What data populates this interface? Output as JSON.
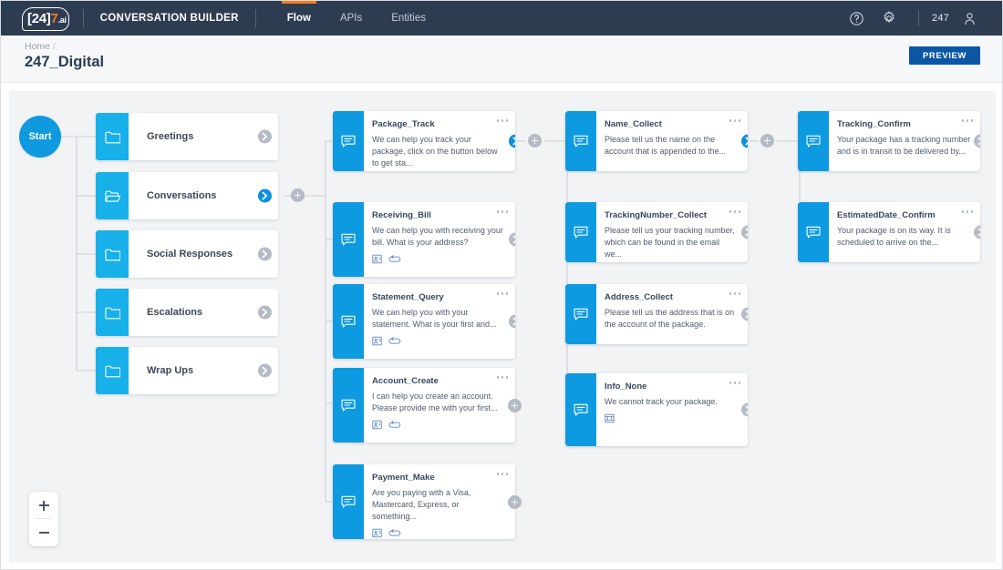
{
  "topnav": {
    "logo": {
      "bracket_left": "[",
      "num24": "24",
      "bracket_right": "]",
      "num7": "7",
      "suffix": ".ai"
    },
    "product": "CONVERSATION BUILDER",
    "tabs": [
      {
        "label": "Flow",
        "active": true
      },
      {
        "label": "APIs",
        "active": false
      },
      {
        "label": "Entities",
        "active": false
      }
    ],
    "help_icon": "question-circle-icon",
    "settings_icon": "gear-icon",
    "account": "247",
    "avatar_icon": "user-icon"
  },
  "subheader": {
    "breadcrumb_home": "Home",
    "breadcrumb_slash": "/",
    "title": "247_Digital",
    "preview_label": "PREVIEW"
  },
  "canvas": {
    "start_label": "Start",
    "zoom_in_label": "+",
    "zoom_out_label": "−"
  },
  "colors": {
    "nav_bg": "#2e3c52",
    "accent_orange": "#f47b20",
    "folder_blue": "#17b0e8",
    "node_blue": "#0e9ae0",
    "start_blue": "#0f9ae0",
    "preview_blue": "#0b57a4",
    "canvas_bg": "#f2f3f5",
    "arrow_grey": "#b4bbc4",
    "arrow_active": "#0b8fe0"
  },
  "folders": [
    {
      "label": "Greetings",
      "icon": "folder-icon",
      "arrow": "chevron-right-icon",
      "arrow_active": false
    },
    {
      "label": "Conversations",
      "icon": "folder-open-icon",
      "arrow": "chevron-right-icon",
      "arrow_active": true
    },
    {
      "label": "Social Responses",
      "icon": "folder-icon",
      "arrow": "chevron-right-icon",
      "arrow_active": false
    },
    {
      "label": "Escalations",
      "icon": "folder-icon",
      "arrow": "chevron-right-icon",
      "arrow_active": false
    },
    {
      "label": "Wrap Ups",
      "icon": "folder-icon",
      "arrow": "chevron-right-icon",
      "arrow_active": false
    }
  ],
  "column2": [
    {
      "title": "Package_Track",
      "text": "We can help you track your package, click on the button below to get sta...",
      "icons": [
        "button-icon"
      ],
      "menu": "more-options-icon",
      "out": "chevron-right-icon",
      "out_active": true
    },
    {
      "title": "Receiving_Bill",
      "text": "We can help you with receiving your bill. What is your address?",
      "icons": [
        "entity-icon",
        "loop-icon"
      ],
      "menu": "more-options-icon",
      "out": "chevron-right-icon",
      "out_active": false
    },
    {
      "title": "Statement_Query",
      "text": "We can help you with your statement. What is your first and...",
      "icons": [
        "entity-icon",
        "loop-icon"
      ],
      "menu": "more-options-icon",
      "out": "chevron-right-icon",
      "out_active": false
    },
    {
      "title": "Account_Create",
      "text": "I can help you create an account. Please provide me with your first...",
      "icons": [
        "entity-icon",
        "loop-icon"
      ],
      "menu": "more-options-icon",
      "out": "plus-icon",
      "out_active": false
    },
    {
      "title": "Payment_Make",
      "text": "Are you paying with a Visa, Mastercard, Express, or something...",
      "icons": [
        "entity-icon",
        "loop-icon"
      ],
      "menu": "more-options-icon",
      "out": "plus-icon",
      "out_active": false
    }
  ],
  "column3": [
    {
      "title": "Name_Collect",
      "text": "Please tell us the name on the account that is appended to the...",
      "icons": [],
      "menu": "more-options-icon",
      "out": "chevron-right-icon",
      "out_active": true
    },
    {
      "title": "TrackingNumber_Collect",
      "text": "Please tell us your tracking number, which can be found in the email we...",
      "icons": [],
      "menu": "more-options-icon",
      "out": "chevron-right-icon",
      "out_active": false
    },
    {
      "title": "Address_Collect",
      "text": "Please tell us the address that is on the account of the package.",
      "icons": [],
      "menu": "more-options-icon",
      "out": "chevron-right-icon",
      "out_active": false
    },
    {
      "title": "Info_None",
      "text": "We cannot track your package.",
      "icons": [
        "button-icon"
      ],
      "menu": "more-options-icon",
      "out": "chevron-right-icon",
      "out_active": false
    }
  ],
  "column4": [
    {
      "title": "Tracking_Confirm",
      "text": "Your package has a tracking number and is in transit to be delivered by...",
      "icons": [],
      "menu": "more-options-icon",
      "out": "chevron-right-icon",
      "out_active": false
    },
    {
      "title": "EstimatedDate_Confirm",
      "text": "Your package is on its way. It is scheduled to arrive on the...",
      "icons": [],
      "menu": "more-options-icon",
      "out": "chevron-right-icon",
      "out_active": false
    }
  ]
}
